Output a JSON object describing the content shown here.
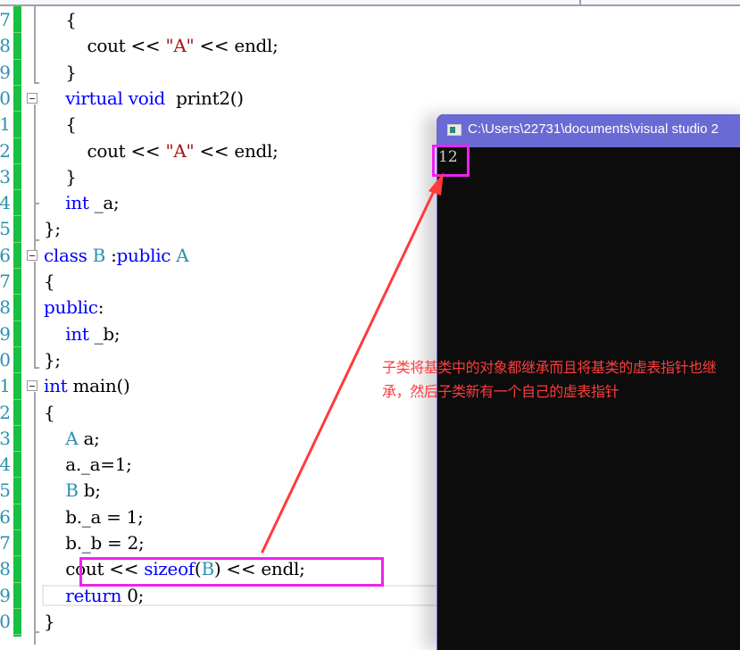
{
  "editor": {
    "lines": [
      {
        "num": "7",
        "tokens": [
          {
            "t": "    {",
            "c": ""
          }
        ]
      },
      {
        "num": "8",
        "tokens": [
          {
            "t": "        cout << ",
            "c": ""
          },
          {
            "t": "\"A\"",
            "c": "str"
          },
          {
            "t": " << endl;",
            "c": ""
          }
        ]
      },
      {
        "num": "9",
        "tokens": [
          {
            "t": "    }",
            "c": ""
          }
        ]
      },
      {
        "num": "0",
        "tokens": [
          {
            "t": "    ",
            "c": ""
          },
          {
            "t": "virtual",
            "c": "kw"
          },
          {
            "t": " ",
            "c": ""
          },
          {
            "t": "void",
            "c": "kw"
          },
          {
            "t": "  print2()",
            "c": ""
          }
        ]
      },
      {
        "num": "1",
        "tokens": [
          {
            "t": "    {",
            "c": ""
          }
        ]
      },
      {
        "num": "2",
        "tokens": [
          {
            "t": "        cout << ",
            "c": ""
          },
          {
            "t": "\"A\"",
            "c": "str"
          },
          {
            "t": " << endl;",
            "c": ""
          }
        ]
      },
      {
        "num": "3",
        "tokens": [
          {
            "t": "    }",
            "c": ""
          }
        ]
      },
      {
        "num": "4",
        "tokens": [
          {
            "t": "    ",
            "c": ""
          },
          {
            "t": "int",
            "c": "kw"
          },
          {
            "t": " _a;",
            "c": ""
          }
        ]
      },
      {
        "num": "5",
        "tokens": [
          {
            "t": "};",
            "c": ""
          }
        ]
      },
      {
        "num": "6",
        "tokens": [
          {
            "t": "class",
            "c": "kw"
          },
          {
            "t": " ",
            "c": ""
          },
          {
            "t": "B",
            "c": "ty"
          },
          {
            "t": " :",
            "c": ""
          },
          {
            "t": "public",
            "c": "kw"
          },
          {
            "t": " ",
            "c": ""
          },
          {
            "t": "A",
            "c": "ty"
          }
        ]
      },
      {
        "num": "7",
        "tokens": [
          {
            "t": "{",
            "c": ""
          }
        ]
      },
      {
        "num": "8",
        "tokens": [
          {
            "t": "public",
            "c": "kw"
          },
          {
            "t": ":",
            "c": ""
          }
        ]
      },
      {
        "num": "9",
        "tokens": [
          {
            "t": "    ",
            "c": ""
          },
          {
            "t": "int",
            "c": "kw"
          },
          {
            "t": " _b;",
            "c": ""
          }
        ]
      },
      {
        "num": "0",
        "tokens": [
          {
            "t": "};",
            "c": ""
          }
        ]
      },
      {
        "num": "1",
        "tokens": [
          {
            "t": "int",
            "c": "kw"
          },
          {
            "t": " main()",
            "c": ""
          }
        ]
      },
      {
        "num": "2",
        "tokens": [
          {
            "t": "{",
            "c": ""
          }
        ]
      },
      {
        "num": "3",
        "tokens": [
          {
            "t": "    ",
            "c": ""
          },
          {
            "t": "A",
            "c": "ty"
          },
          {
            "t": " a;",
            "c": ""
          }
        ]
      },
      {
        "num": "4",
        "tokens": [
          {
            "t": "    a._a=1;",
            "c": ""
          }
        ]
      },
      {
        "num": "5",
        "tokens": [
          {
            "t": "    ",
            "c": ""
          },
          {
            "t": "B",
            "c": "ty"
          },
          {
            "t": " b;",
            "c": ""
          }
        ]
      },
      {
        "num": "6",
        "tokens": [
          {
            "t": "    b._a = 1;",
            "c": ""
          }
        ]
      },
      {
        "num": "7",
        "tokens": [
          {
            "t": "    b._b = 2;",
            "c": ""
          }
        ]
      },
      {
        "num": "8",
        "tokens": [
          {
            "t": "    cout << ",
            "c": ""
          },
          {
            "t": "sizeof",
            "c": "kw"
          },
          {
            "t": "(",
            "c": ""
          },
          {
            "t": "B",
            "c": "ty"
          },
          {
            "t": ") << endl;",
            "c": ""
          }
        ]
      },
      {
        "num": "9",
        "tokens": [
          {
            "t": "    ",
            "c": ""
          },
          {
            "t": "return",
            "c": "kw"
          },
          {
            "t": " 0;",
            "c": ""
          }
        ]
      },
      {
        "num": "0",
        "tokens": [
          {
            "t": "}",
            "c": ""
          }
        ]
      }
    ]
  },
  "console": {
    "title": "C:\\Users\\22731\\documents\\visual studio 2",
    "output": "12"
  },
  "annotation": {
    "text": "子类将基类中的对象都继承而且将基类的虚表指针也继承，然后子类新有一个自己的虚表指针",
    "color": "#ff3b3b"
  },
  "colors": {
    "highlight_box": "#ee22ee",
    "console_title_bar": "#6a6ad4",
    "change_margin": "#18c040"
  }
}
